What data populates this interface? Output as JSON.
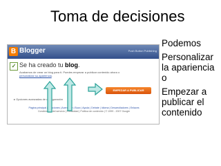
{
  "slide": {
    "title": "Toma de decisiones",
    "bullets": [
      "Podemos",
      "Personalizar la apariencia o",
      "Empezar a publicar el contenido"
    ]
  },
  "screenshot": {
    "brand": "Blogger",
    "header_right": "Push Button Publishing",
    "heading_prefix": "Se ha creado tu ",
    "heading_bold": "blog",
    "intro_line1": "Acabamos de crear un blog para ti. Puedes empezar a publicar contenido ahora o",
    "intro_link": "personalizar su apariencia",
    "start_button": "EMPEZAR A PUBLICAR",
    "options_text": "Opciones avanzadas de configuración",
    "footer_line1": "Página principal | Funciones | Acerca de | Buzz | Ayuda | Debate | Idioma | Desarrolladores | Enlaces",
    "footer_line2": "Condiciones del servicio | Privacidad | Política de contenido | © 1999 - 2007 Google"
  },
  "colors": {
    "header_top": "#6f89b6",
    "header_bottom": "#324f8a",
    "logo": "#f57c00",
    "button": "#e8661b",
    "arrow_teal": "#2aa198",
    "arrow_teal_fill": "#bfe9e6"
  },
  "icons": {
    "logo": "blogger-logo-icon",
    "check": "check-icon",
    "options": "triangle-bullet-icon"
  }
}
